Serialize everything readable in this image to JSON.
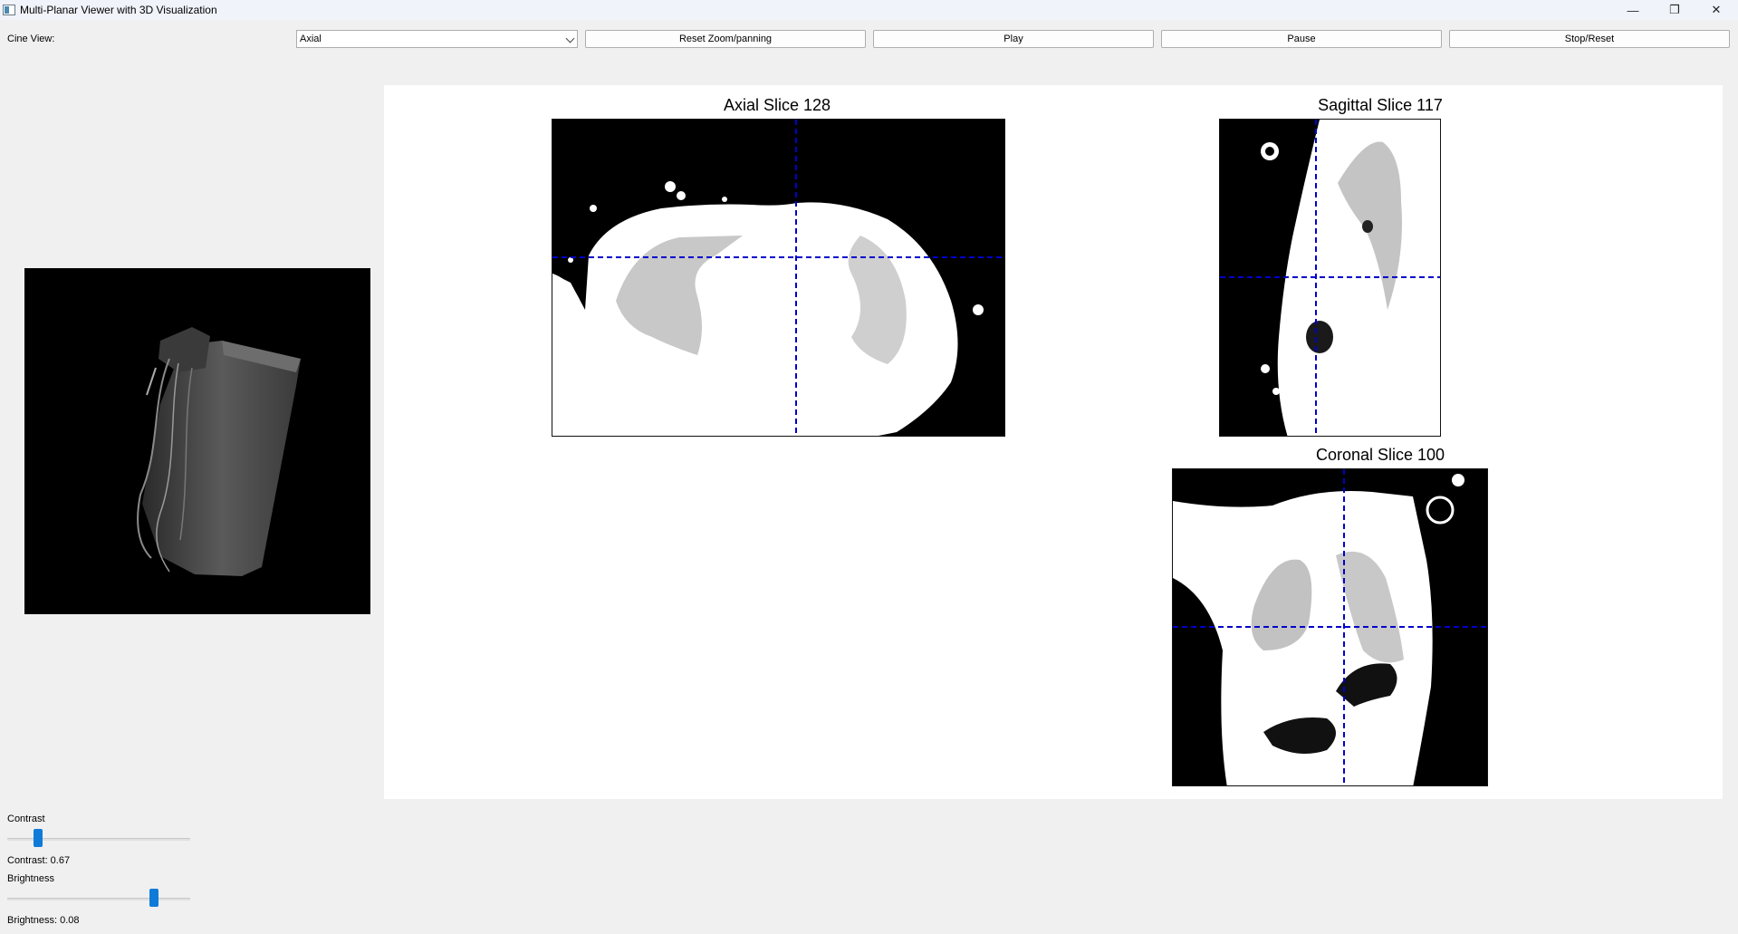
{
  "window": {
    "title": "Multi-Planar Viewer with 3D Visualization"
  },
  "toolbar": {
    "cine_label": "Cine View:",
    "cine_value": "Axial",
    "reset_label": "Reset Zoom/panning",
    "play_label": "Play",
    "pause_label": "Pause",
    "stop_label": "Stop/Reset"
  },
  "views": {
    "axial_title": "Axial Slice 128",
    "sagittal_title": "Sagittal Slice 117",
    "coronal_title": "Coronal Slice 100"
  },
  "controls": {
    "contrast_label": "Contrast",
    "contrast_value_text": "Contrast: 0.67",
    "contrast_level": 0.15,
    "brightness_label": "Brightness",
    "brightness_value_text": "Brightness: 0.08",
    "brightness_level": 0.82
  },
  "colors": {
    "crosshair": "#0000cc",
    "slider_thumb": "#0f7bd9"
  }
}
